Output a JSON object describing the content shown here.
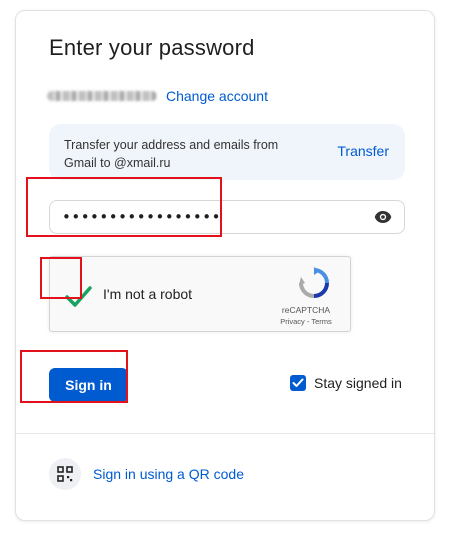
{
  "header": {
    "title": "Enter your password"
  },
  "account": {
    "change_label": "Change account"
  },
  "transfer": {
    "text": "Transfer your address and emails from Gmail to @xmail.ru",
    "link_label": "Transfer"
  },
  "password": {
    "masked_value": "•••••••••••••••••",
    "toggle_icon": "eye-icon"
  },
  "captcha": {
    "label": "I'm not a robot",
    "checked": true,
    "brand": "reCAPTCHA",
    "links": "Privacy - Terms"
  },
  "actions": {
    "signin_label": "Sign in",
    "stay_signed_in_label": "Stay signed in",
    "stay_signed_in_checked": true
  },
  "qr": {
    "label": "Sign in using a QR code",
    "icon": "qr-code-icon"
  },
  "colors": {
    "accent": "#005bd1",
    "highlight": "#e3111b",
    "check_green": "#1aa260"
  }
}
